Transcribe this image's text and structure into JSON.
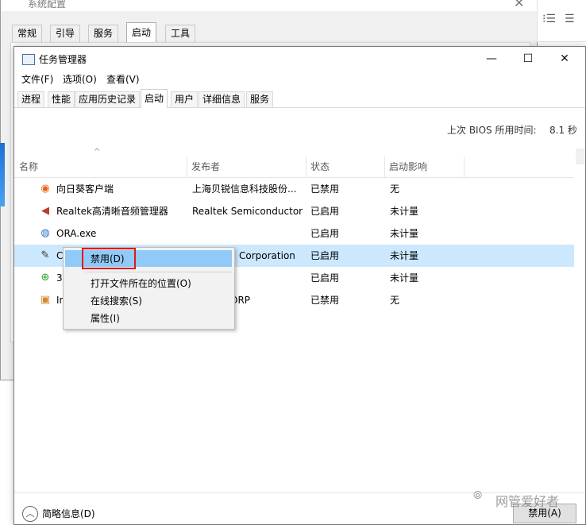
{
  "msconfig": {
    "title": "系统配置",
    "close": "✕",
    "tabs": [
      "常规",
      "引导",
      "服务",
      "启动",
      "工具"
    ]
  },
  "background_app": {
    "icon1": "⁝☰",
    "icon2": "☰"
  },
  "task_manager": {
    "title": "任务管理器",
    "window_buttons": {
      "minimize": "—",
      "maximize": "☐",
      "close": "✕"
    },
    "menu": [
      "文件(F)",
      "选项(O)",
      "查看(V)"
    ],
    "tabs": [
      "进程",
      "性能",
      "应用历史记录",
      "启动",
      "用户",
      "详细信息",
      "服务"
    ],
    "active_tab": "启动",
    "bios_time_label": "上次 BIOS 所用时间:",
    "bios_time_value": "8.1 秒",
    "columns": [
      "名称",
      "发布者",
      "状态",
      "启动影响"
    ],
    "sort_indicator": "^",
    "rows": [
      {
        "icon": "sunflower-icon",
        "glyph": "◉",
        "color": "#e8641a",
        "name": "向日葵客户端",
        "publisher": "上海贝锐信息科技股份...",
        "status": "已禁用",
        "impact": "无"
      },
      {
        "icon": "speaker-icon",
        "glyph": "🔈",
        "color": "#c0392b",
        "name": "Realtek高清晰音频管理器",
        "publisher": "Realtek Semiconductor",
        "status": "已启用",
        "impact": "未计量"
      },
      {
        "icon": "globe-icon",
        "glyph": "◍",
        "color": "#2b6fd0",
        "name": "ORA.exe",
        "publisher": "",
        "status": "已启用",
        "impact": "未计量"
      },
      {
        "icon": "notepad-icon",
        "glyph": "✎",
        "color": "#333333",
        "name": "C",
        "publisher": "Corporation",
        "status": "已启用",
        "impact": "未计量"
      },
      {
        "icon": "360-icon",
        "glyph": "⊕",
        "color": "#2da52d",
        "name": "3(",
        "publisher": "",
        "status": "已启用",
        "impact": "未计量"
      },
      {
        "icon": "app-icon",
        "glyph": "▣",
        "color": "#d08a2a",
        "name": "In",
        "publisher": "ORP",
        "status": "已禁用",
        "impact": "无"
      }
    ],
    "context_menu": [
      "禁用(D)",
      "打开文件所在的位置(O)",
      "在线搜索(S)",
      "属性(I)"
    ],
    "fewer_details": "简略信息(D)",
    "disable_button": "禁用(A)"
  },
  "watermark": {
    "text": "网管爱好者"
  },
  "colors": {
    "selection": "#cce8ff",
    "menu_highlight": "#91c9f7",
    "red_box": "#e01919"
  }
}
